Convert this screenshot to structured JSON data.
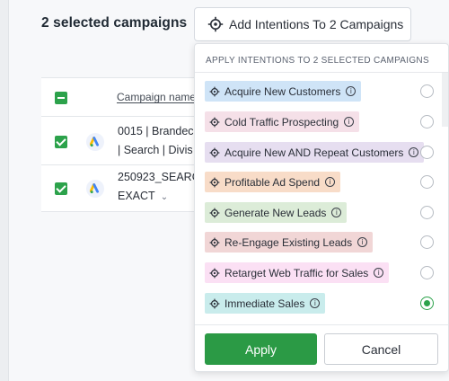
{
  "selection": {
    "title": "2 selected campaigns"
  },
  "add_button": {
    "label": "Add Intentions To 2 Campaigns",
    "icon": "target-icon"
  },
  "table": {
    "column_header": "Campaign name",
    "rows": [
      {
        "checked": true,
        "line1": "0015 | Brandec",
        "line2": "| Search | Divis"
      },
      {
        "checked": true,
        "line1": "250923_SEARC",
        "line2": "EXACT"
      }
    ]
  },
  "dropdown": {
    "heading": "APPLY INTENTIONS TO 2 SELECTED CAMPAIGNS",
    "options": [
      {
        "label": "Acquire New Customers",
        "color": "#cfe4f7",
        "selected": false
      },
      {
        "label": "Cold Traffic Prospecting",
        "color": "#f5e0e8",
        "selected": false
      },
      {
        "label": "Acquire New AND Repeat Customers",
        "color": "#e6def0",
        "selected": false
      },
      {
        "label": "Profitable Ad Spend",
        "color": "#f8dcc8",
        "selected": false
      },
      {
        "label": "Generate New Leads",
        "color": "#dcecd8",
        "selected": false
      },
      {
        "label": "Re-Engage Existing Leads",
        "color": "#f1d6d6",
        "selected": false
      },
      {
        "label": "Retarget Web Traffic for Sales",
        "color": "#fbe0f4",
        "selected": false
      },
      {
        "label": "Immediate Sales",
        "color": "#c9ecec",
        "selected": true
      }
    ],
    "apply_label": "Apply",
    "cancel_label": "Cancel"
  },
  "colors": {
    "accent_green": "#2b9a45",
    "checkbox_green": "#2ca24b",
    "google_ads_blue": "#4285f4",
    "google_ads_yellow": "#fbbc04"
  }
}
